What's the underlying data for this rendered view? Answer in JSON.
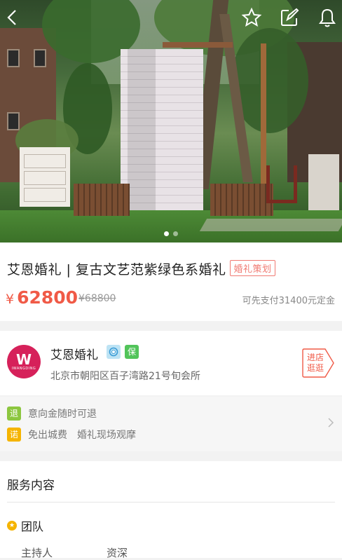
{
  "hero": {
    "carousel_active": 0,
    "carousel_count": 2
  },
  "top_actions": {
    "back_icon": "chevron-left-icon",
    "favorite_icon": "star-icon",
    "share_icon": "share-edit-icon",
    "notify_icon": "bell-icon"
  },
  "product": {
    "title": "艾恩婚礼 | 复古文艺范紫绿色系婚礼",
    "tag": "婚礼策划",
    "currency": "¥",
    "price": "62800",
    "original_price": "¥68800",
    "deposit_note": "可先支付31400元定金"
  },
  "shop": {
    "logo_letter": "W",
    "logo_sub": "IWANGDING",
    "name": "艾恩婚礼",
    "badge_guarantee": "保",
    "address": "北京市朝阳区百子湾路21号旬会所",
    "enter_line1": "进店",
    "enter_line2": "逛逛"
  },
  "promises": {
    "row1_badge": "退",
    "row1_text": "意向金随时可退",
    "row2_badge": "诺",
    "row2_items": [
      "免出城费",
      "婚礼现场观摩"
    ]
  },
  "service": {
    "title": "服务内容",
    "team_label": "团队",
    "roles": [
      "主持人",
      "资深"
    ]
  },
  "colors": {
    "accent": "#f05a47",
    "tag": "#f07a72",
    "logo": "#d6215a",
    "badge_refund": "#8cc63f",
    "badge_promise": "#f5b400",
    "badge_guarantee": "#52c45a"
  }
}
